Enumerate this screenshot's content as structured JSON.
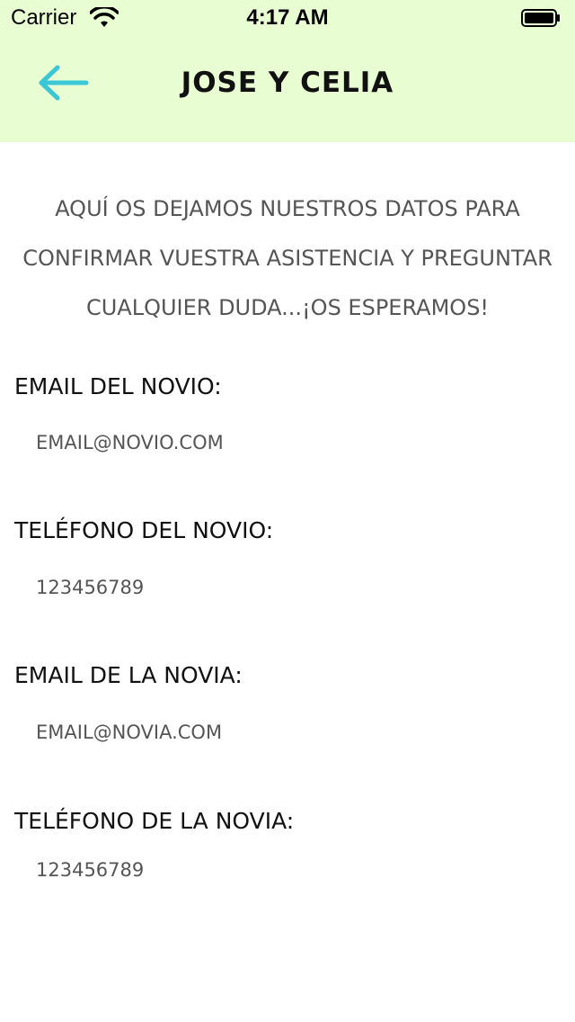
{
  "status_bar": {
    "carrier": "Carrier",
    "time": "4:17 AM"
  },
  "nav": {
    "title": "JOSE Y CELIA",
    "back_icon": "arrow-left-icon",
    "accent_color": "#3bc7d6",
    "background_color": "#e9fdd3"
  },
  "intro": {
    "line1": "AQUÍ OS DEJAMOS NUESTROS DATOS PARA",
    "line2": "CONFIRMAR VUESTRA ASISTENCIA Y PREGUNTAR",
    "line3": "CUALQUIER DUDA...¡OS ESPERAMOS!"
  },
  "contacts": [
    {
      "label": "EMAIL DEL NOVIO:",
      "value": "EMAIL@NOVIO.COM"
    },
    {
      "label": "TELÉFONO DEL NOVIO:",
      "value": "123456789"
    },
    {
      "label": "EMAIL DE LA NOVIA:",
      "value": "EMAIL@NOVIA.COM"
    },
    {
      "label": "TELÉFONO DE LA NOVIA:",
      "value": "123456789"
    }
  ]
}
